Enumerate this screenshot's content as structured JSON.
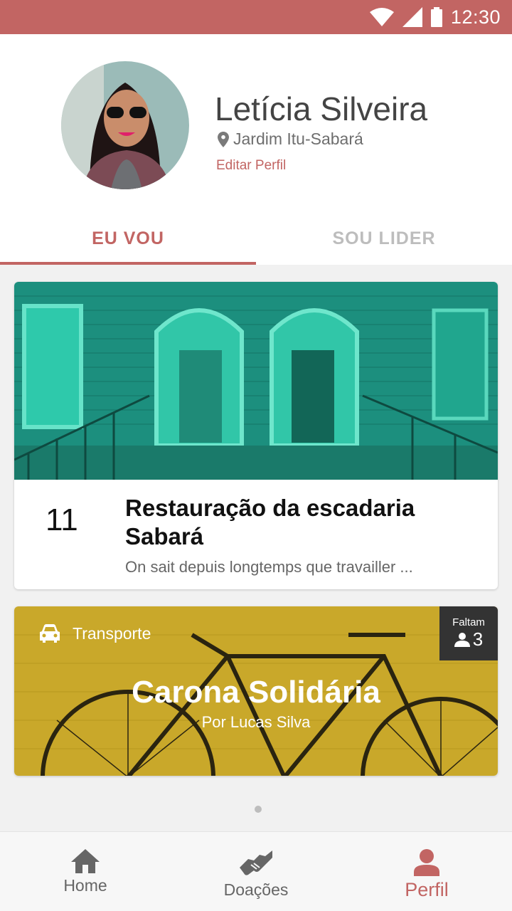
{
  "status_bar": {
    "time": "12:30"
  },
  "profile": {
    "name": "Letícia Silveira",
    "location": "Jardim Itu-Sabará",
    "edit_label": "Editar Perfil"
  },
  "tabs": [
    {
      "label": "EU VOU",
      "active": true
    },
    {
      "label": "SOU LIDER",
      "active": false
    }
  ],
  "event_card": {
    "day": "11",
    "title": "Restauração da escadaria Sabará",
    "description": "On sait depuis longtemps que travailler ..."
  },
  "activity_card": {
    "category": "Transporte",
    "badge_label": "Faltam",
    "badge_count": "3",
    "title": "Carona Solidária",
    "subtitle": "Por Lucas Silva"
  },
  "bottom_nav": [
    {
      "label": "Home",
      "icon": "home-icon",
      "active": false
    },
    {
      "label": "Doações",
      "icon": "handshake-icon",
      "active": false
    },
    {
      "label": "Perfil",
      "icon": "person-icon",
      "active": true
    }
  ],
  "colors": {
    "accent": "#c26563",
    "teal_overlay": "#2fc1a4",
    "yellow_overlay": "#c9a82a"
  }
}
